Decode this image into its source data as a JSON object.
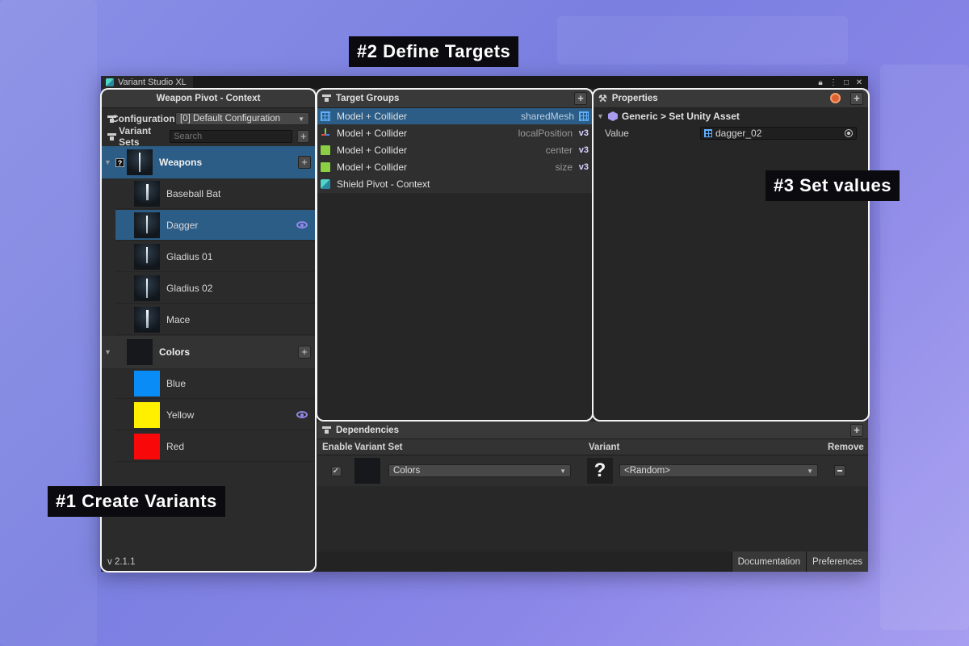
{
  "window": {
    "title": "Variant Studio XL"
  },
  "left": {
    "title": "Weapon Pivot - Context",
    "configuration_label": "Configuration",
    "configuration_value": "[0] Default Configuration",
    "variant_sets_label": "Variant Sets",
    "search_placeholder": "Search",
    "sets": [
      {
        "name": "Weapons",
        "variants": [
          "Baseball Bat",
          "Dagger",
          "Gladius 01",
          "Gladius 02",
          "Mace"
        ]
      },
      {
        "name": "Colors",
        "variants": [
          "Blue",
          "Yellow",
          "Red"
        ],
        "swatches": [
          "#0a8cf7",
          "#fff000",
          "#f80808"
        ]
      }
    ],
    "selected_variant": "Dagger",
    "version": "v 2.1.1"
  },
  "target_groups": {
    "title": "Target Groups",
    "rows": [
      {
        "name": "Model + Collider",
        "property": "sharedMesh",
        "type_icon": "mesh-icon"
      },
      {
        "name": "Model + Collider",
        "property": "localPosition",
        "type_icon": "v3"
      },
      {
        "name": "Model + Collider",
        "property": "center",
        "type_icon": "v3"
      },
      {
        "name": "Model + Collider",
        "property": "size",
        "type_icon": "v3"
      },
      {
        "name": "Shield Pivot - Context",
        "property": "",
        "type_icon": ""
      }
    ],
    "v3_label": "v3"
  },
  "properties": {
    "title": "Properties",
    "action": "Generic > Set Unity Asset",
    "value_label": "Value",
    "value": "dagger_02"
  },
  "dependencies": {
    "title": "Dependencies",
    "columns": {
      "enable": "Enable",
      "variant_set": "Variant Set",
      "variant": "Variant",
      "remove": "Remove"
    },
    "row": {
      "enabled": true,
      "check": "✓",
      "variant_set": "Colors",
      "variant": "<Random>",
      "variant_thumb": "?"
    }
  },
  "footer": {
    "documentation": "Documentation",
    "preferences": "Preferences"
  },
  "callouts": {
    "one": "#1 Create Variants",
    "two": "#2 Define Targets",
    "three": "#3 Set values"
  },
  "colors": {
    "selection": "#2c5d87",
    "accent": "#8f87e6",
    "outline": "#f4f4f4"
  }
}
